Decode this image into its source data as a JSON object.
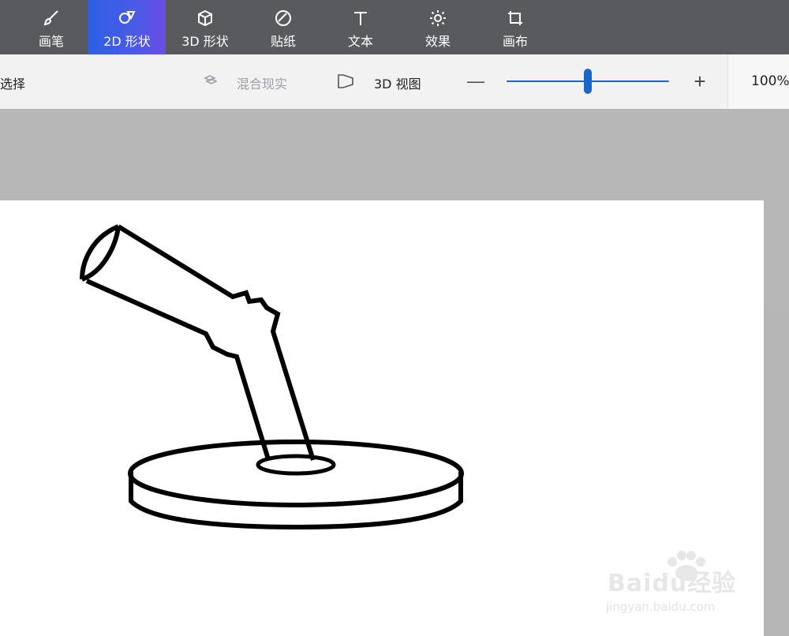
{
  "app": {
    "tabs": [
      {
        "label": "画笔",
        "icon": "brush-icon",
        "active": false
      },
      {
        "label": "2D 形状",
        "icon": "shapes-2d-icon",
        "active": true
      },
      {
        "label": "3D 形状",
        "icon": "cube-3d-icon",
        "active": false
      },
      {
        "label": "贴纸",
        "icon": "sticker-icon",
        "active": false
      },
      {
        "label": "文本",
        "icon": "text-icon",
        "active": false
      },
      {
        "label": "效果",
        "icon": "sun-effects-icon",
        "active": false
      },
      {
        "label": "画布",
        "icon": "canvas-crop-icon",
        "active": false
      }
    ],
    "secondary": {
      "select_label": "选择",
      "mixed_reality_label": "混合现实",
      "view3d_label": "3D 视图",
      "zoom_minus": "—",
      "zoom_plus": "+",
      "zoom_value_text": "100%",
      "zoom_level_fraction": 0.5
    },
    "colors": {
      "accent": "#1a66c6",
      "topbar": "#595a5e",
      "active_tab_start": "#2f5fe6",
      "active_tab_end": "#6a4de6"
    },
    "watermark": {
      "text_top": "Baidu经验",
      "text_bottom": "jingyan.baidu.com"
    }
  }
}
